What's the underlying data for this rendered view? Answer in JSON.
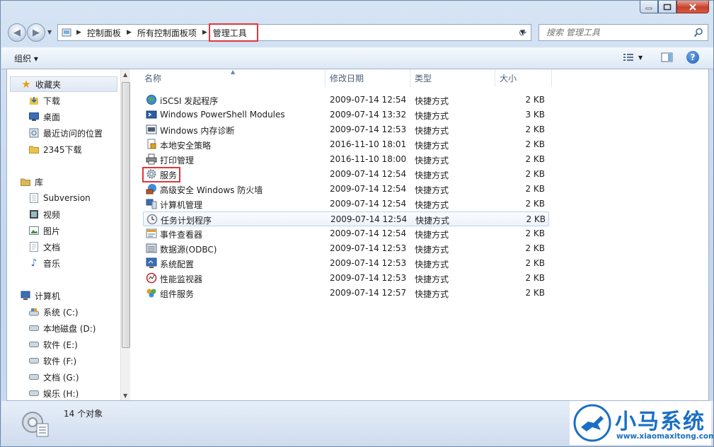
{
  "address": {
    "crumbs": [
      "控制面板",
      "所有控制面板项",
      "管理工具"
    ]
  },
  "search": {
    "placeholder": "搜索 管理工具"
  },
  "toolbar": {
    "organize_label": "组织 ▾"
  },
  "columns": {
    "name": "名称",
    "modified": "修改日期",
    "type": "类型",
    "size": "大小"
  },
  "sidebar": {
    "favorites": {
      "label": "收藏夹",
      "items": [
        "下载",
        "桌面",
        "最近访问的位置",
        "2345下载"
      ]
    },
    "libraries": {
      "label": "库",
      "items": [
        "Subversion",
        "视频",
        "图片",
        "文档",
        "音乐"
      ]
    },
    "computer": {
      "label": "计算机",
      "items": [
        "系统 (C:)",
        "本地磁盘 (D:)",
        "软件 (E:)",
        "软件 (F:)",
        "文档 (G:)",
        "娱乐 (H:)"
      ]
    }
  },
  "files": [
    {
      "name": "iSCSI 发起程序",
      "date": "2009-07-14 12:54",
      "type": "快捷方式",
      "size": "2 KB",
      "icon": "globe-icon"
    },
    {
      "name": "Windows PowerShell Modules",
      "date": "2009-07-14 13:32",
      "type": "快捷方式",
      "size": "3 KB",
      "icon": "powershell-icon"
    },
    {
      "name": "Windows 内存诊断",
      "date": "2009-07-14 12:53",
      "type": "快捷方式",
      "size": "2 KB",
      "icon": "memory-icon"
    },
    {
      "name": "本地安全策略",
      "date": "2016-11-10 18:01",
      "type": "快捷方式",
      "size": "2 KB",
      "icon": "security-policy-icon"
    },
    {
      "name": "打印管理",
      "date": "2016-11-10 18:00",
      "type": "快捷方式",
      "size": "2 KB",
      "icon": "printer-icon"
    },
    {
      "name": "服务",
      "date": "2009-07-14 12:54",
      "type": "快捷方式",
      "size": "2 KB",
      "icon": "gear-icon"
    },
    {
      "name": "高级安全 Windows 防火墙",
      "date": "2009-07-14 12:54",
      "type": "快捷方式",
      "size": "2 KB",
      "icon": "firewall-icon"
    },
    {
      "name": "计算机管理",
      "date": "2009-07-14 12:54",
      "type": "快捷方式",
      "size": "2 KB",
      "icon": "computer-management-icon"
    },
    {
      "name": "任务计划程序",
      "date": "2009-07-14 12:54",
      "type": "快捷方式",
      "size": "2 KB",
      "icon": "clock-icon"
    },
    {
      "name": "事件查看器",
      "date": "2009-07-14 12:54",
      "type": "快捷方式",
      "size": "2 KB",
      "icon": "event-viewer-icon"
    },
    {
      "name": "数据源(ODBC)",
      "date": "2009-07-14 12:53",
      "type": "快捷方式",
      "size": "2 KB",
      "icon": "database-icon"
    },
    {
      "name": "系统配置",
      "date": "2009-07-14 12:53",
      "type": "快捷方式",
      "size": "2 KB",
      "icon": "system-config-icon"
    },
    {
      "name": "性能监视器",
      "date": "2009-07-14 12:53",
      "type": "快捷方式",
      "size": "2 KB",
      "icon": "performance-icon"
    },
    {
      "name": "组件服务",
      "date": "2009-07-14 12:57",
      "type": "快捷方式",
      "size": "2 KB",
      "icon": "component-services-icon"
    }
  ],
  "status": {
    "count": "14 个对象"
  },
  "watermark": {
    "brand": "小马系统",
    "url": "www.xiaomaxitong.com"
  }
}
